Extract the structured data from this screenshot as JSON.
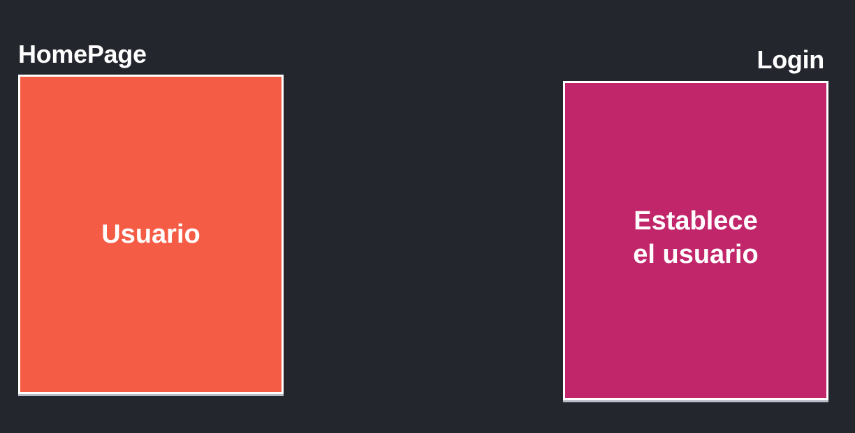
{
  "homepage": {
    "title": "HomePage",
    "box_text": "Usuario",
    "box_color": "#f55c45"
  },
  "login": {
    "title": "Login",
    "box_lines": [
      "Establece",
      "el usuario"
    ],
    "box_color": "#c1266b"
  },
  "colors": {
    "background": "#24262e",
    "border": "#ffffff",
    "text": "#ffffff"
  }
}
